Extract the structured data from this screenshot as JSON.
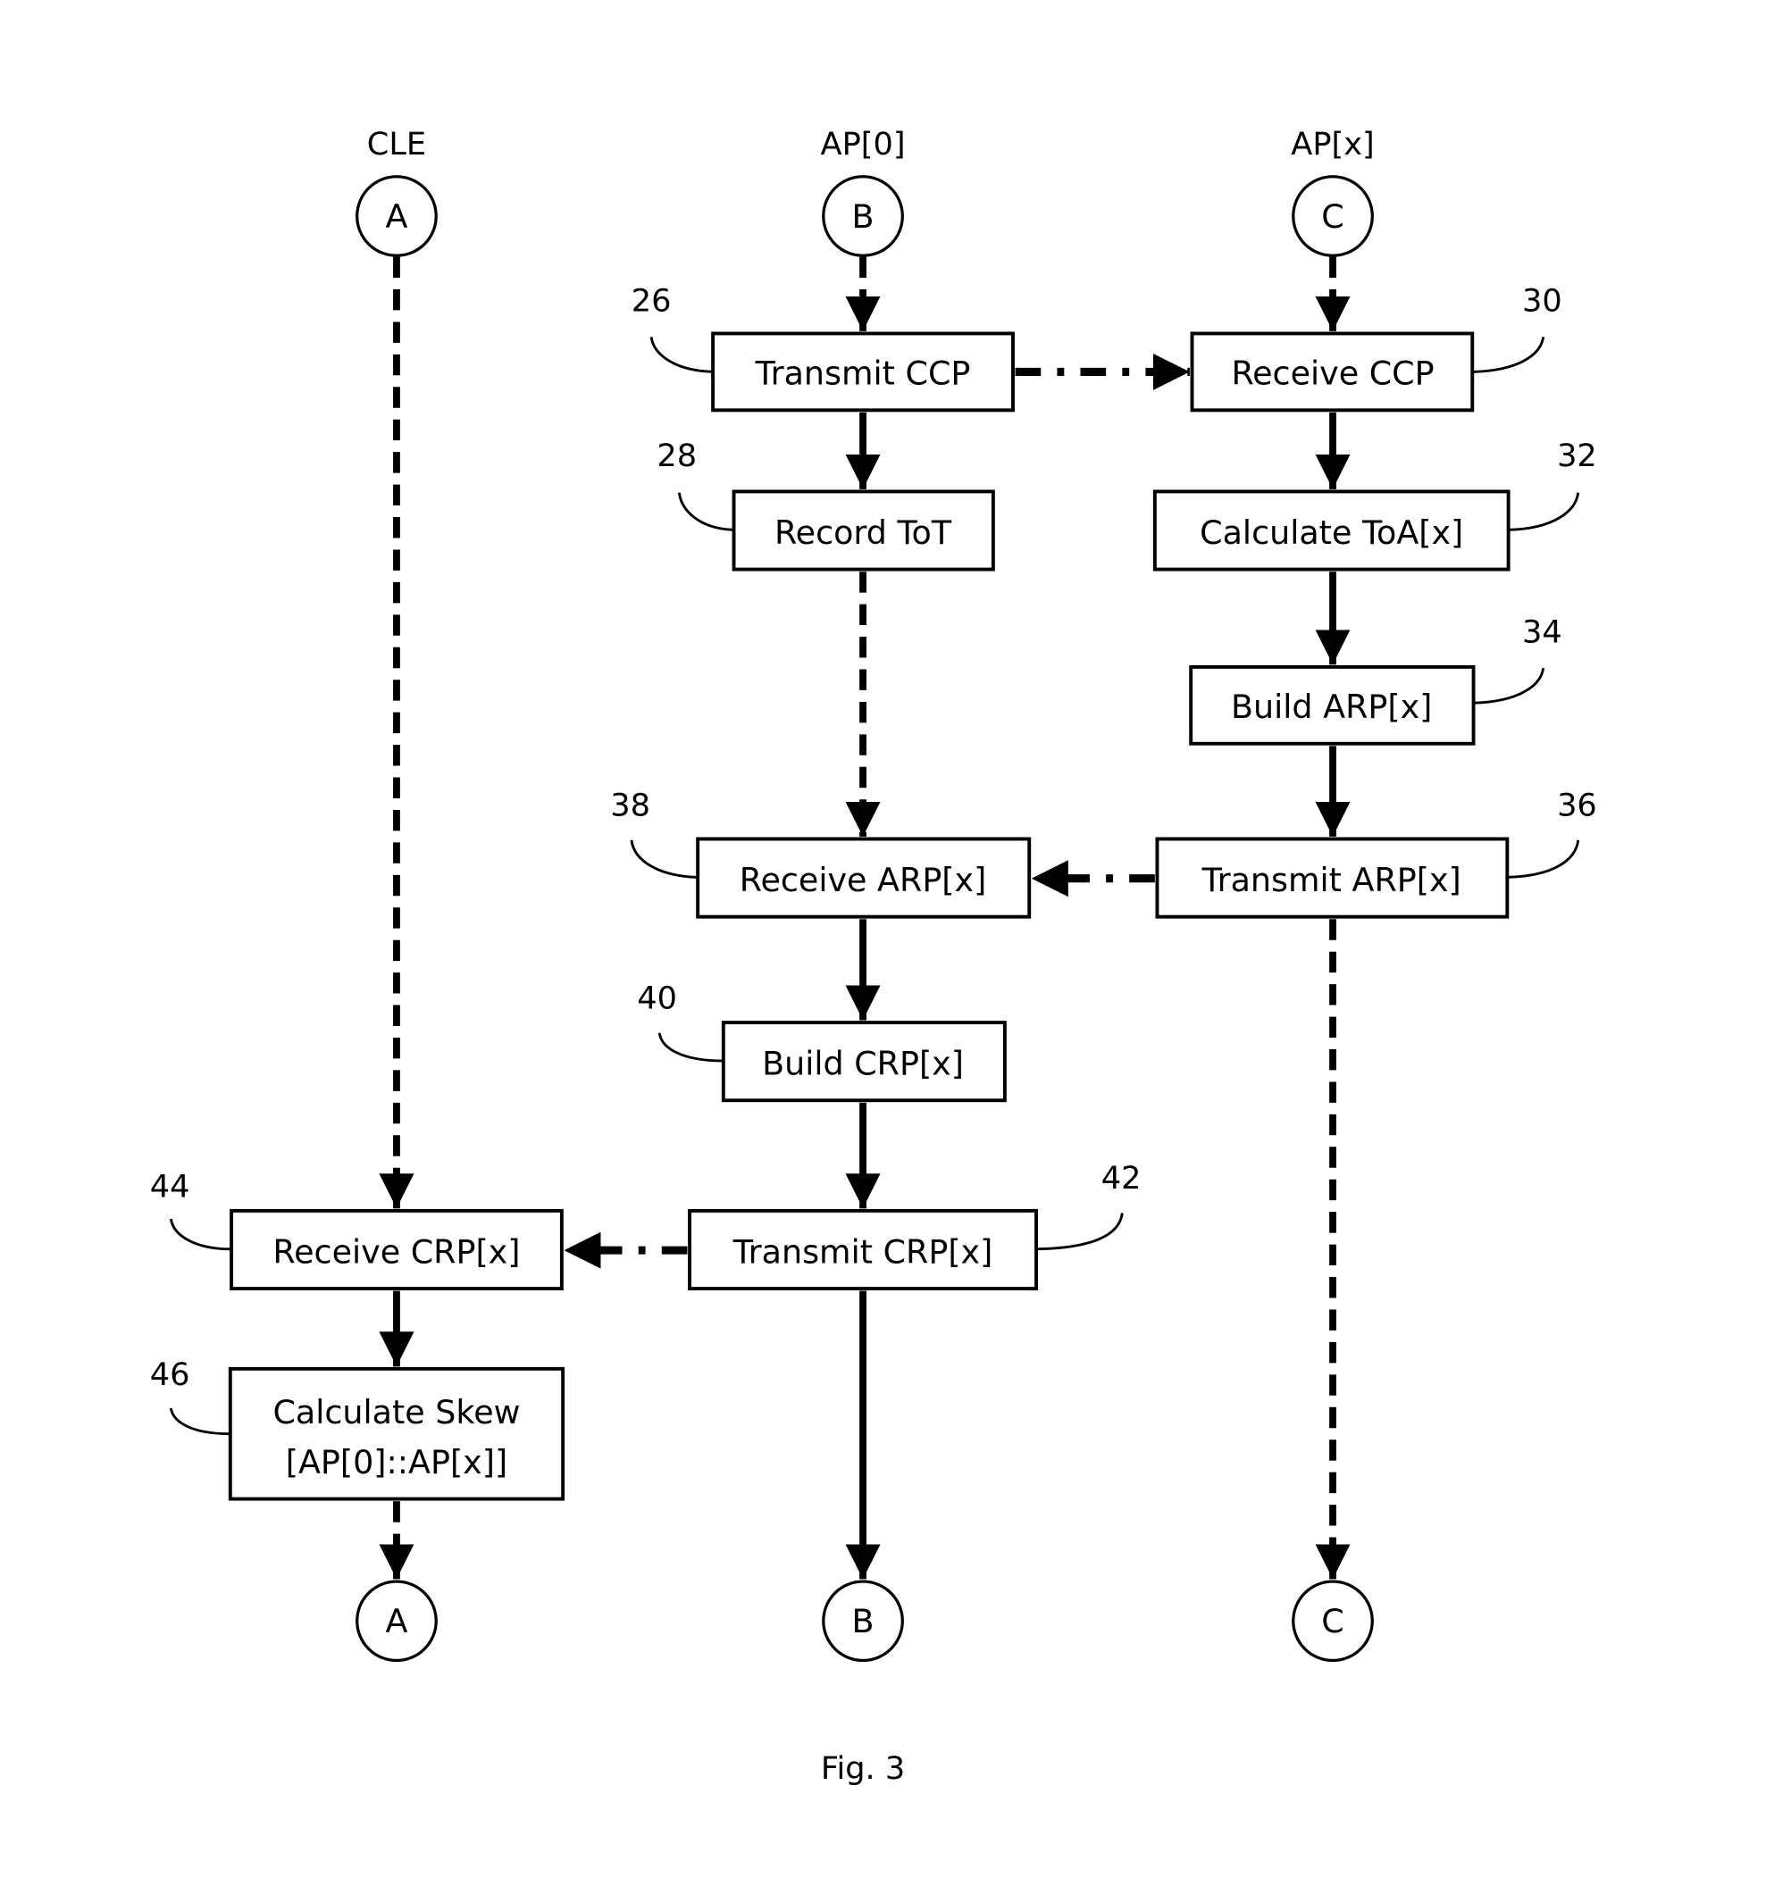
{
  "figure": {
    "caption": "Fig. 3",
    "lanes": [
      {
        "id": "cle",
        "title": "CLE",
        "connector_top": "A",
        "connector_bottom": "A"
      },
      {
        "id": "ap0",
        "title": "AP[0]",
        "connector_top": "B",
        "connector_bottom": "B"
      },
      {
        "id": "apx",
        "title": "AP[x]",
        "connector_top": "C",
        "connector_bottom": "C"
      }
    ],
    "steps": [
      {
        "id": "s26",
        "ref": "26",
        "lane": "ap0",
        "label": "Transmit CCP"
      },
      {
        "id": "s28",
        "ref": "28",
        "lane": "ap0",
        "label": "Record ToT"
      },
      {
        "id": "s38",
        "ref": "38",
        "lane": "ap0",
        "label": "Receive ARP[x]"
      },
      {
        "id": "s40",
        "ref": "40",
        "lane": "ap0",
        "label": "Build CRP[x]"
      },
      {
        "id": "s42",
        "ref": "42",
        "lane": "ap0",
        "label": "Transmit CRP[x]"
      },
      {
        "id": "s30",
        "ref": "30",
        "lane": "apx",
        "label": "Receive CCP"
      },
      {
        "id": "s32",
        "ref": "32",
        "lane": "apx",
        "label": "Calculate ToA[x]"
      },
      {
        "id": "s34",
        "ref": "34",
        "lane": "apx",
        "label": "Build ARP[x]"
      },
      {
        "id": "s36",
        "ref": "36",
        "lane": "apx",
        "label": "Transmit ARP[x]"
      },
      {
        "id": "s44",
        "ref": "44",
        "lane": "cle",
        "label": "Receive CRP[x]"
      },
      {
        "id": "s46",
        "ref": "46",
        "lane": "cle",
        "label_line1": "Calculate Skew",
        "label_line2": "[AP[0]::AP[x]]"
      }
    ],
    "edges": [
      {
        "from": "B-top",
        "to": "s26",
        "style": "dashed"
      },
      {
        "from": "s26",
        "to": "s28",
        "style": "solid"
      },
      {
        "from": "s28",
        "to": "s38",
        "style": "dashed"
      },
      {
        "from": "s38",
        "to": "s40",
        "style": "solid"
      },
      {
        "from": "s40",
        "to": "s42",
        "style": "solid"
      },
      {
        "from": "s42",
        "to": "B-bottom",
        "style": "solid"
      },
      {
        "from": "C-top",
        "to": "s30",
        "style": "dashed"
      },
      {
        "from": "s30",
        "to": "s32",
        "style": "solid"
      },
      {
        "from": "s32",
        "to": "s34",
        "style": "solid"
      },
      {
        "from": "s34",
        "to": "s36",
        "style": "solid"
      },
      {
        "from": "s36",
        "to": "C-bottom",
        "style": "dashed"
      },
      {
        "from": "A-top",
        "to": "s44",
        "style": "dashed"
      },
      {
        "from": "s44",
        "to": "s46",
        "style": "solid"
      },
      {
        "from": "s46",
        "to": "A-bottom",
        "style": "dashed"
      },
      {
        "from": "s26",
        "to": "s30",
        "style": "dash-dot"
      },
      {
        "from": "s36",
        "to": "s38",
        "style": "dash-dot"
      },
      {
        "from": "s42",
        "to": "s44",
        "style": "dash-dot"
      }
    ]
  }
}
